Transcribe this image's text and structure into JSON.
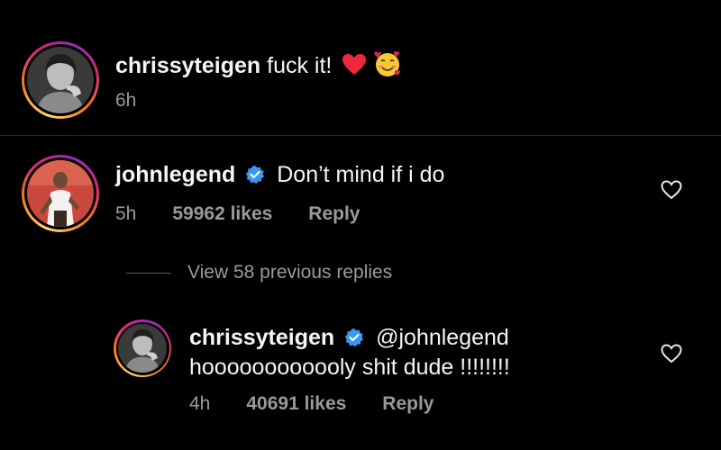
{
  "post": {
    "username": "chrissyteigen",
    "caption": "fuck it!",
    "emojis": [
      "red-heart",
      "smiling-face-with-hearts"
    ],
    "time": "6h"
  },
  "comment": {
    "username": "johnlegend",
    "verified": true,
    "text": "Don’t mind if i do",
    "time": "5h",
    "likes": "59962 likes",
    "reply_label": "Reply"
  },
  "view_replies": "View 58 previous replies",
  "reply": {
    "username": "chrissyteigen",
    "verified": true,
    "mention": "@johnlegend",
    "text": "hoooooooooooly shit dude !!!!!!!!",
    "time": "4h",
    "likes": "40691 likes",
    "reply_label": "Reply"
  },
  "colors": {
    "background": "#000000",
    "text": "#f5f5f5",
    "muted": "#9a9a9a",
    "verified_badge": "#3897f0",
    "heart": "#ed4956"
  }
}
